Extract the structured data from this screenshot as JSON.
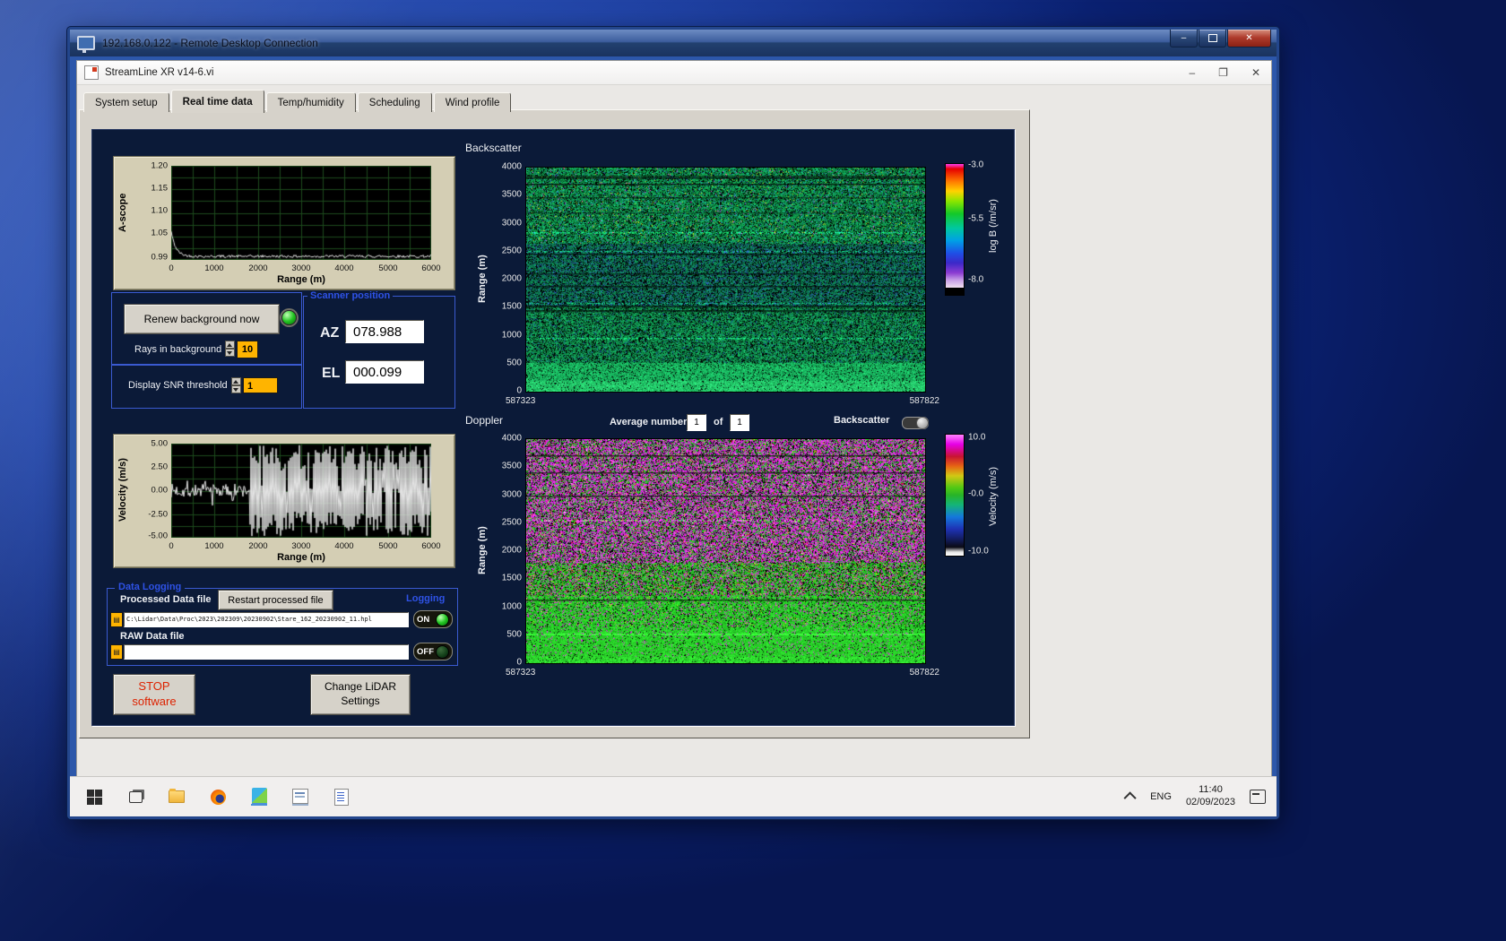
{
  "rdp": {
    "title": "192.168.0.122 - Remote Desktop Connection"
  },
  "app": {
    "title": "StreamLine XR v14-6.vi",
    "tabs": [
      "System setup",
      "Real time data",
      "Temp/humidity",
      "Scheduling",
      "Wind profile"
    ],
    "active_tab": "Real time data"
  },
  "ascope": {
    "ylabel": "A-scope",
    "xlabel": "Range (m)",
    "yticks": [
      "1.20",
      "1.15",
      "1.10",
      "1.05",
      "0.99"
    ],
    "xticks": [
      "0",
      "1000",
      "2000",
      "3000",
      "4000",
      "5000",
      "6000"
    ]
  },
  "background_ctrl": {
    "renew_button": "Renew background now",
    "rays_label": "Rays in background",
    "rays_value": "10",
    "snr_label": "Display SNR threshold",
    "snr_value": "1"
  },
  "scanner": {
    "title": "Scanner position",
    "az_label": "AZ",
    "az_value": "078.988",
    "el_label": "EL",
    "el_value": "000.099"
  },
  "velocity": {
    "ylabel": "Velocity (m/s)",
    "xlabel": "Range (m)",
    "yticks": [
      "5.00",
      "2.50",
      "0.00",
      "-2.50",
      "-5.00"
    ],
    "xticks": [
      "0",
      "1000",
      "2000",
      "3000",
      "4000",
      "5000",
      "6000"
    ]
  },
  "logging": {
    "title": "Data Logging",
    "processed_label": "Processed Data file",
    "restart_button": "Restart processed file",
    "logging_label": "Logging",
    "processed_path": "C:\\Lidar\\Data\\Proc\\2023\\202309\\20230902\\Stare_162_20230902_11.hpl",
    "processed_state": "ON",
    "raw_label": "RAW Data file",
    "raw_path": "",
    "raw_state": "OFF"
  },
  "actions": {
    "stop_line1": "STOP",
    "stop_line2": "software",
    "change_line1": "Change LiDAR",
    "change_line2": "Settings"
  },
  "backscatter": {
    "title": "Backscatter",
    "ylabel": "Range (m)",
    "yticks": [
      "4000",
      "3500",
      "3000",
      "2500",
      "2000",
      "1500",
      "1000",
      "500",
      "0"
    ],
    "x_first": "587323",
    "x_last": "587822",
    "cb_ticks": [
      "-3.0",
      "-5.5",
      "-8.0"
    ],
    "cb_label": "log B (/m/sr)"
  },
  "doppler": {
    "title": "Doppler",
    "avg_label": "Average number",
    "avg_value": "1",
    "of_label": "of",
    "of_total": "1",
    "toggle_label": "Backscatter",
    "ylabel": "Range (m)",
    "yticks": [
      "4000",
      "3500",
      "3000",
      "2500",
      "2000",
      "1500",
      "1000",
      "500",
      "0"
    ],
    "x_first": "587323",
    "x_last": "587822",
    "cb_ticks": [
      "10.0",
      "-0.0",
      "-10.0"
    ],
    "cb_label": "Velocity (m/s)"
  },
  "taskbar": {
    "lang": "ENG",
    "time": "11:40",
    "date": "02/09/2023"
  },
  "colors": {
    "led_on": "#23c523",
    "value_amber": "#ffb400",
    "panel_navy": "#0b1a38",
    "group_blue": "#3a5ad0",
    "stop_red": "#dd2200"
  }
}
